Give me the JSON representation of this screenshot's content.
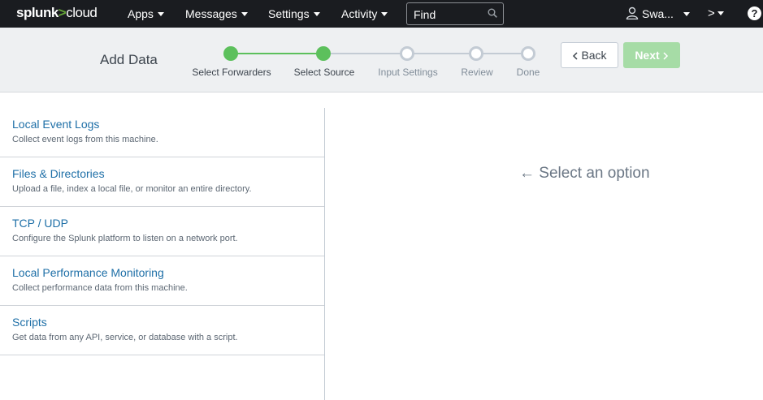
{
  "nav": {
    "logo_part1": "splunk",
    "logo_part2": ">",
    "logo_part3": "cloud",
    "menus": [
      "Apps",
      "Messages",
      "Settings",
      "Activity"
    ],
    "search_placeholder": "Find",
    "user_label": "Swa...",
    "prompt_label": ">",
    "help_label": "?"
  },
  "header": {
    "title": "Add Data",
    "steps": [
      {
        "label": "Select Forwarders",
        "state": "done"
      },
      {
        "label": "Select Source",
        "state": "current"
      },
      {
        "label": "Input Settings",
        "state": "pending"
      },
      {
        "label": "Review",
        "state": "pending"
      },
      {
        "label": "Done",
        "state": "pending"
      }
    ],
    "back_label": "Back",
    "next_label": "Next"
  },
  "sources": [
    {
      "title": "Local Event Logs",
      "description": "Collect event logs from this machine."
    },
    {
      "title": "Files & Directories",
      "description": "Upload a file, index a local file, or monitor an entire directory."
    },
    {
      "title": "TCP / UDP",
      "description": "Configure the Splunk platform to listen on a network port."
    },
    {
      "title": "Local Performance Monitoring",
      "description": "Collect performance data from this machine."
    },
    {
      "title": "Scripts",
      "description": "Get data from any API, service, or database with a script."
    }
  ],
  "main": {
    "hint": "Select an option",
    "hint_arrow": "←"
  },
  "colors": {
    "nav_bg": "#1a1c20",
    "accent_green": "#5cc05c",
    "link_blue": "#1e6fa7"
  }
}
